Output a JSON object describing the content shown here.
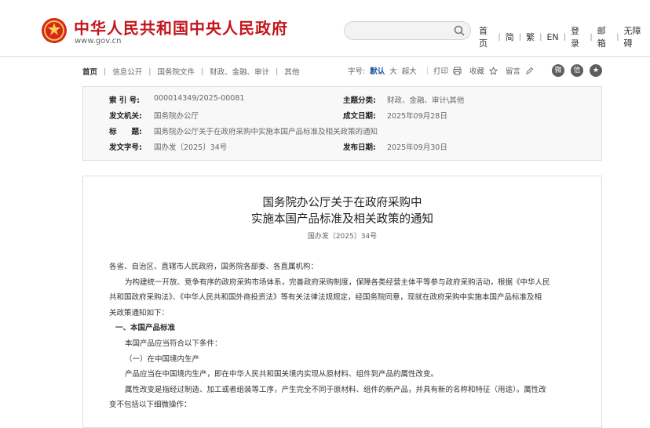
{
  "header": {
    "site_name": "中华人民共和国中央人民政府",
    "site_url": "www.gov.cn",
    "nav": [
      "首页",
      "简",
      "繁",
      "EN",
      "登录",
      "邮箱",
      "无障碍"
    ]
  },
  "breadcrumb": [
    "首页",
    "信息公开",
    "国务院文件",
    "财政、金融、审计",
    "其他"
  ],
  "tools": {
    "font_label": "字号:",
    "font_sizes": [
      "默认",
      "大",
      "超大"
    ],
    "print": "打印",
    "favorite": "收藏",
    "comment": "留言"
  },
  "meta": {
    "index_label": "索 引 号:",
    "index_value": "000014349/2025-00081",
    "category_label": "主题分类:",
    "category_value": "财政、金融、审计\\其他",
    "issuer_label": "发文机关:",
    "issuer_value": "国务院办公厅",
    "date_label": "成文日期:",
    "date_value": "2025年09月28日",
    "title_label": "标　　题:",
    "title_value": "国务院办公厅关于在政府采购中实施本国产品标准及相关政策的通知",
    "docno_label": "发文字号:",
    "docno_value": "国办发〔2025〕34号",
    "publish_label": "发布日期:",
    "publish_value": "2025年09月30日"
  },
  "article": {
    "title_line1": "国务院办公厅关于在政府采购中",
    "title_line2": "实施本国产品标准及相关政策的通知",
    "doc_number": "国办发〔2025〕34号",
    "salutation": "各省、自治区、直辖市人民政府，国务院各部委、各直属机构：",
    "para1_line1": "为构建统一开放、竞争有序的政府采购市场体系，完善政府采购制度，保障各类经营主体平等参与政府采购活动，根据《中华人民",
    "para1_line2": "共和国政府采购法》、《中华人民共和国外商投资法》等有关法律法规规定，经国务院同意，现就在政府采购中实施本国产品标准及相",
    "para1_line3": "关政策通知如下：",
    "section1": "一、本国产品标准",
    "para2": "本国产品应当符合以下条件：",
    "sub1": "（一）在中国境内生产",
    "para3": "产品应当在中国境内生产，即在中华人民共和国关境内实现从原材料、组件到产品的属性改变。",
    "para4_line1": "属性改变是指经过制造、加工或者组装等工序，产生完全不同于原材料、组件的新产品，并具有新的名称和特征（用途）。属性改",
    "para4_line2": "变不包括以下细微操作："
  },
  "icons": [
    "national-emblem",
    "search-icon",
    "print-icon",
    "star-icon",
    "pencil-icon",
    "weibo-icon",
    "wechat-icon",
    "favorite-icon"
  ],
  "colors": {
    "brand_red": "#c3161c",
    "link_blue": "#1a52a6"
  }
}
